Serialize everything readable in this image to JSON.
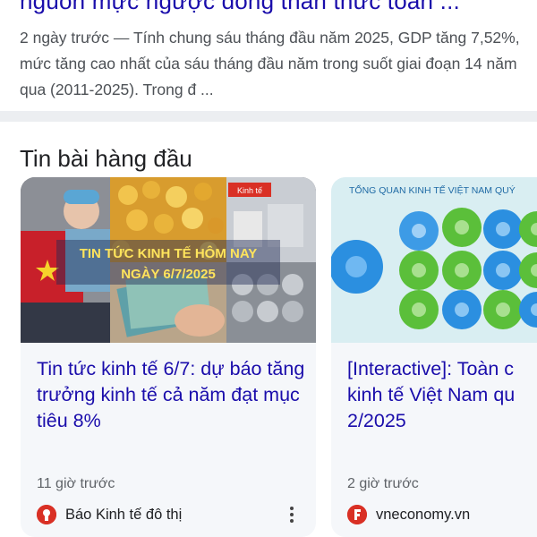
{
  "top_result": {
    "cut_title": "nguồn mực ngược dòng thần thức toàn ...",
    "snippet": "2 ngày trước — Tính chung sáu tháng đầu năm 2025, GDP tăng 7,52%, mức tăng cao nhất của sáu tháng đầu năm trong suốt giai đoạn 14 năm qua (2011-2025). Trong đ ..."
  },
  "top_stories": {
    "heading": "Tin bài hàng đầu",
    "cards": [
      {
        "image_text_line1": "TIN TỨC KINH TẾ HÔM NAY",
        "image_text_line2": "NGÀY 6/7/2025",
        "image_badge": "Kinh tế",
        "title": "Tin tức kinh tế 6/7: dự báo tăng trưởng kinh tế cả năm đạt mục tiêu 8%",
        "time": "11 giờ trước",
        "source": "Báo Kinh tế đô thị",
        "logo_color": "#d93025"
      },
      {
        "image_text": "TỔNG QUAN KINH TẾ VIỆT NAM QUÝ",
        "title": "[Interactive]: Toàn c\nkinh tế Việt Nam qu\n2/2025",
        "time": "2 giờ trước",
        "source": "vneconomy.vn",
        "logo_color": "#d93025"
      }
    ]
  },
  "colors": {
    "link": "#1a0dab",
    "snippet": "#4d5156",
    "card_bg": "#f5f7fa"
  }
}
